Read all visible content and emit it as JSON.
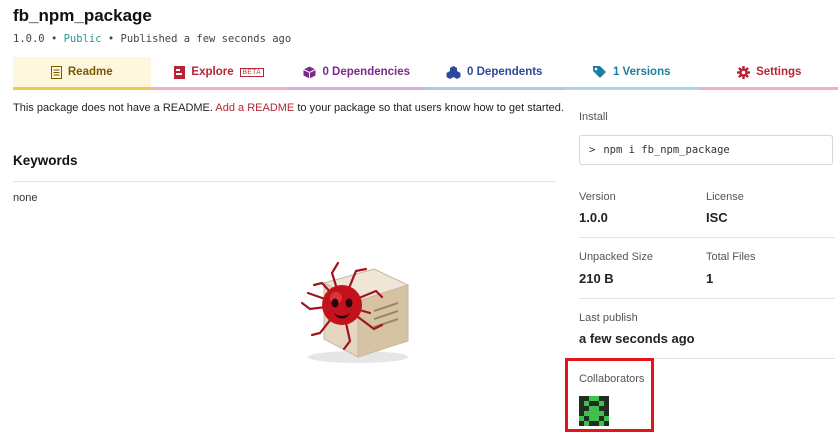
{
  "package": {
    "name": "fb_npm_package",
    "version": "1.0.0",
    "visibility": "Public",
    "published": "Published a few seconds ago",
    "separator": "•"
  },
  "tabs": [
    {
      "label": "Readme",
      "icon": "readme-doc-icon",
      "active": true,
      "color": "#7a5a00"
    },
    {
      "label": "Explore",
      "icon": "explore-box-icon",
      "badge": "BETA",
      "color": "#b52535"
    },
    {
      "label": "0 Dependencies",
      "icon": "cube-icon",
      "color": "#7a2a8a"
    },
    {
      "label": "0 Dependents",
      "icon": "cubes-icon",
      "color": "#2b4a9c"
    },
    {
      "label": "1 Versions",
      "icon": "tag-icon",
      "color": "#1a7fa0"
    },
    {
      "label": "Settings",
      "icon": "gear-icon",
      "color": "#b52535"
    }
  ],
  "readme": {
    "before": "This package does not have a README.",
    "link": "Add a README",
    "after": "to your package so that users know how to get started."
  },
  "keywords": {
    "heading": "Keywords",
    "value": "none"
  },
  "sidebar": {
    "install_label": "Install",
    "install_prompt": ">",
    "install_command": "npm i fb_npm_package",
    "version_label": "Version",
    "version_value": "1.0.0",
    "license_label": "License",
    "license_value": "ISC",
    "unpacked_label": "Unpacked Size",
    "unpacked_value": "210 B",
    "files_label": "Total Files",
    "files_value": "1",
    "last_publish_label": "Last publish",
    "last_publish_value": "a few seconds ago",
    "collaborators_label": "Collaborators"
  },
  "colors": {
    "accent_red": "#b52535",
    "public_green": "#1d9b8f",
    "highlight_red": "#e3151a"
  }
}
